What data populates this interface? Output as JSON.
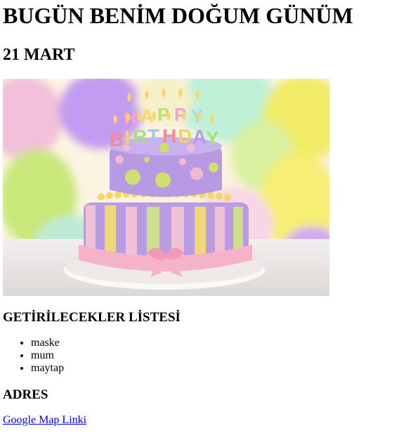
{
  "page": {
    "title": "BUGÜN BENİM DOĞUM GÜNÜM",
    "date": "21 MART"
  },
  "image": {
    "cake_letters": [
      "H",
      "A",
      "P",
      "P",
      "Y",
      "B",
      "I",
      "R",
      "T",
      "H",
      "D",
      "A",
      "Y"
    ],
    "colors": {
      "background": "#f3e9c8",
      "balloon_purple": "#c9a4f0",
      "balloon_green": "#c9ea7a",
      "balloon_yellow": "#f4ea5a",
      "balloon_pink": "#f6c6dc",
      "cake_purple": "#b79ae2",
      "cake_dot_green": "#cfe070",
      "ribbon_pink": "#f4b3c8",
      "stripe_yellow": "#f1dc74",
      "stripe_green": "#cfe388",
      "plate": "#f4f1ef",
      "table": "#e7e4e2"
    }
  },
  "bring_list": {
    "heading": "GETİRİLECEKLER LİSTESİ",
    "items": [
      "maske",
      "mum",
      "maytap"
    ]
  },
  "address": {
    "heading": "ADRES",
    "link_text": "Google Map Linki"
  }
}
